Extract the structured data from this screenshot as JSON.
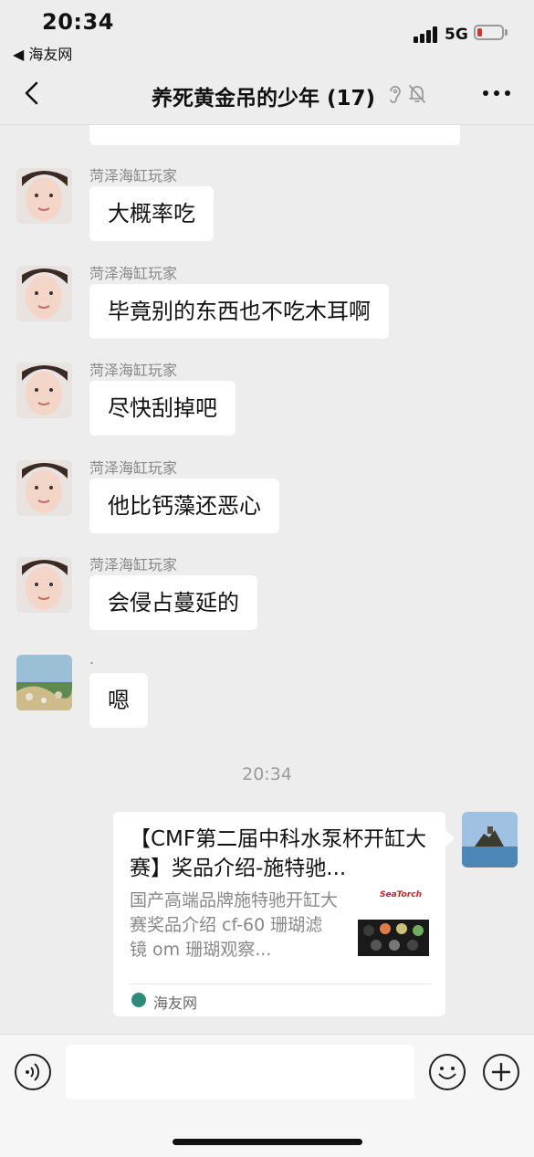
{
  "status_bar": {
    "time": "20:34",
    "back_app": "◀ 海友网",
    "network": "5G"
  },
  "nav": {
    "title": "养死黄金吊的少年 (17)"
  },
  "messages": [
    {
      "sender": "菏泽海缸玩家",
      "text": "大概率吃"
    },
    {
      "sender": "菏泽海缸玩家",
      "text": "毕竟别的东西也不吃木耳啊"
    },
    {
      "sender": "菏泽海缸玩家",
      "text": "尽快刮掉吧"
    },
    {
      "sender": "菏泽海缸玩家",
      "text": "他比钙藻还恶心"
    },
    {
      "sender": "菏泽海缸玩家",
      "text": "会侵占蔓延的"
    },
    {
      "sender": ".",
      "text": "嗯"
    }
  ],
  "timestamp": "20:34",
  "link_card": {
    "title": "【CMF第二届中科水泵杯开缸大赛】奖品介绍-施特驰...",
    "description": "国产高端品牌施特驰开缸大赛奖品介绍 cf-60 珊瑚滤镜 om 珊瑚观察...",
    "source": "海友网",
    "thumb_logo": "SeaTorch"
  },
  "input": {
    "placeholder": ""
  },
  "colors": {
    "background": "#ededed",
    "bubble": "#ffffff",
    "meta_text": "#888888",
    "battery_low": "#e0302c"
  }
}
